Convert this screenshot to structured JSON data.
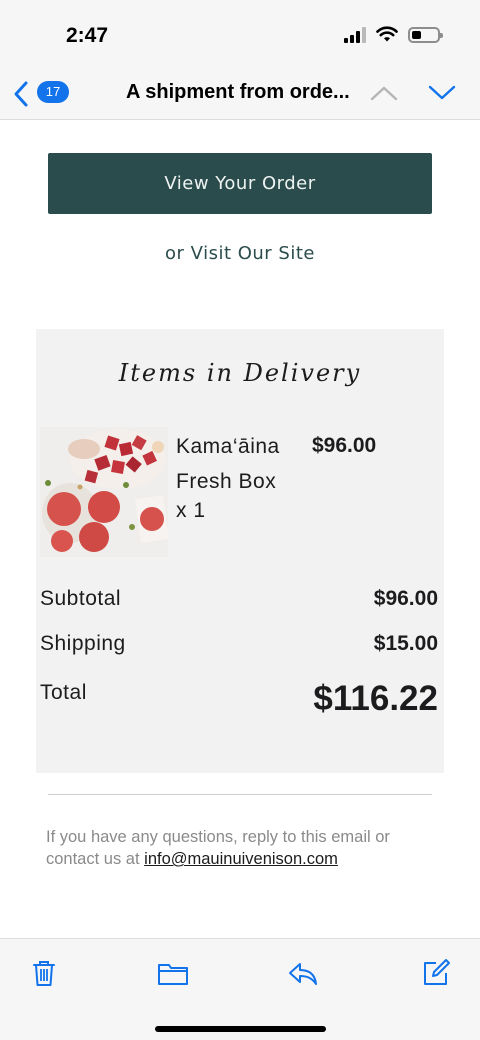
{
  "status_bar": {
    "time": "2:47",
    "icons": [
      "cellular-signal-icon",
      "wifi-icon",
      "battery-icon"
    ]
  },
  "nav": {
    "back_icon": "chevron-left-icon",
    "unread_count": "17",
    "title": "A shipment from orde...",
    "prev_icon": "chevron-up-icon",
    "next_icon": "chevron-down-icon",
    "accent_color": "#1273eb"
  },
  "email": {
    "view_order_label": "View Your Order",
    "visit_site_text": "or Visit Our Site",
    "brand_color": "#2b4c4c",
    "items": {
      "heading": "Items in Delivery",
      "products": [
        {
          "name": "Kama‘āina Fresh Box",
          "quantity": "x 1",
          "price": "$96.00"
        }
      ]
    },
    "summary": {
      "subtotal_label": "Subtotal",
      "subtotal_value": "$96.00",
      "shipping_label": "Shipping",
      "shipping_value": "$15.00",
      "total_label": "Total",
      "total_value": "$116.22"
    },
    "footer": {
      "text": "If you have any questions, reply to this email or contact us at",
      "email_link": "info@mauinuivenison.com"
    }
  },
  "toolbar": {
    "icons": [
      "trash-icon",
      "folder-icon",
      "reply-icon",
      "compose-icon"
    ]
  }
}
